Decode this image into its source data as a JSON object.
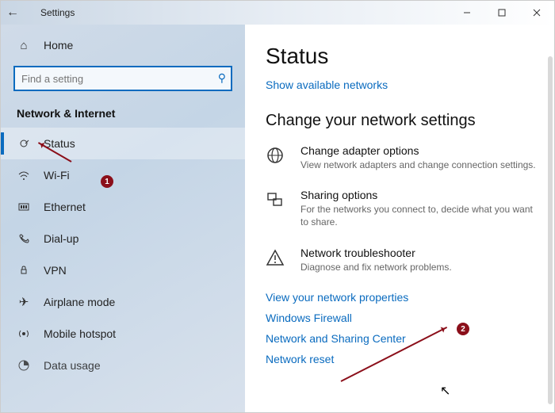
{
  "titlebar": {
    "title": "Settings"
  },
  "sidebar": {
    "home": "Home",
    "search_placeholder": "Find a setting",
    "section": "Network & Internet",
    "items": [
      {
        "label": "Status"
      },
      {
        "label": "Wi-Fi"
      },
      {
        "label": "Ethernet"
      },
      {
        "label": "Dial-up"
      },
      {
        "label": "VPN"
      },
      {
        "label": "Airplane mode"
      },
      {
        "label": "Mobile hotspot"
      },
      {
        "label": "Data usage"
      }
    ]
  },
  "main": {
    "heading": "Status",
    "show_networks": "Show available networks",
    "change_heading": "Change your network settings",
    "rows": [
      {
        "label": "Change adapter options",
        "desc": "View network adapters and change connection settings."
      },
      {
        "label": "Sharing options",
        "desc": "For the networks you connect to, decide what you want to share."
      },
      {
        "label": "Network troubleshooter",
        "desc": "Diagnose and fix network problems."
      }
    ],
    "links": [
      "View your network properties",
      "Windows Firewall",
      "Network and Sharing Center",
      "Network reset"
    ]
  },
  "annotations": {
    "a1": "1",
    "a2": "2"
  }
}
